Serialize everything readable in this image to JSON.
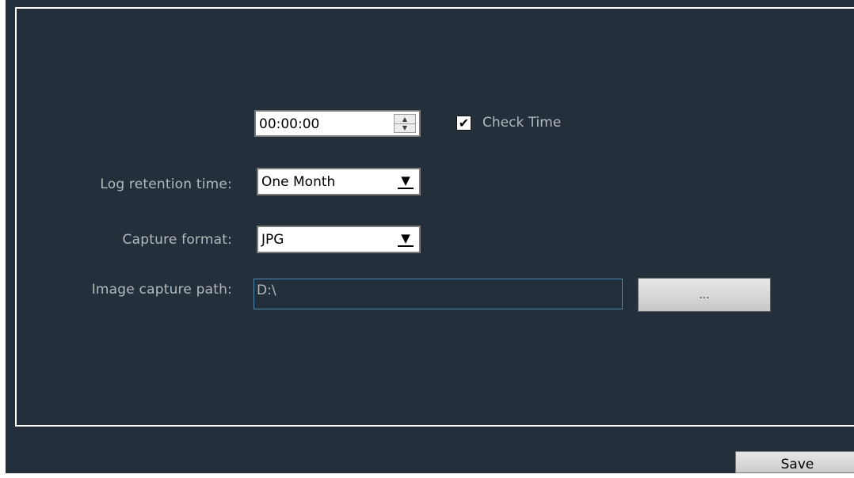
{
  "time_setting": {
    "value": "00:00:00",
    "check_label": "Check Time",
    "checked": true,
    "check_mark": "✔"
  },
  "log_retention": {
    "label": "Log retention time:",
    "value": "One Month"
  },
  "capture_format": {
    "label": "Capture format:",
    "value": "JPG"
  },
  "image_capture_path": {
    "label": "Image capture path:",
    "value": "D:\\"
  },
  "browse_button_label": "...",
  "save_button_label": "Save",
  "icons": {
    "spin_up": "▲",
    "spin_down": "▼",
    "dropdown_arrow": "▼"
  },
  "colors": {
    "background": "#232f3a",
    "label_text": "#b4b9be",
    "input_border": "#4f89b0"
  }
}
